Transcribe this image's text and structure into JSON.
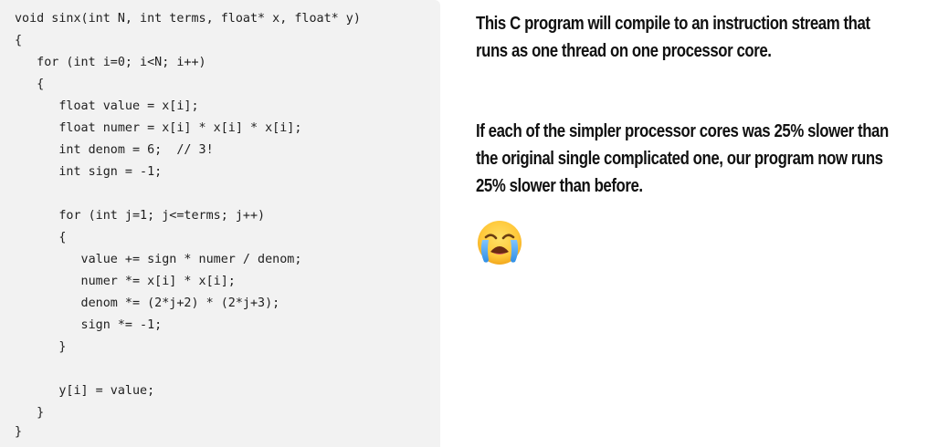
{
  "code": {
    "lines": [
      "void sinx(int N, int terms, float* x, float* y)",
      "{",
      "   for (int i=0; i<N; i++)",
      "   {",
      "      float value = x[i];",
      "      float numer = x[i] * x[i] * x[i];",
      "      int denom = 6;  // 3!",
      "      int sign = -1;",
      "",
      "      for (int j=1; j<=terms; j++)",
      "      {",
      "         value += sign * numer / denom;",
      "         numer *= x[i] * x[i];",
      "         denom *= (2*j+2) * (2*j+3);",
      "         sign *= -1;",
      "      }",
      "",
      "      y[i] = value;",
      "   }",
      "}"
    ]
  },
  "text": {
    "paragraph1": "This C program will compile to an instruction stream that runs as one thread on one processor core.",
    "paragraph2": "If each of the simpler processor cores was 25% slower than the original single complicated one, our program now runs 25% slower than before."
  },
  "icons": {
    "emoji": "loudly-crying-face-icon"
  }
}
